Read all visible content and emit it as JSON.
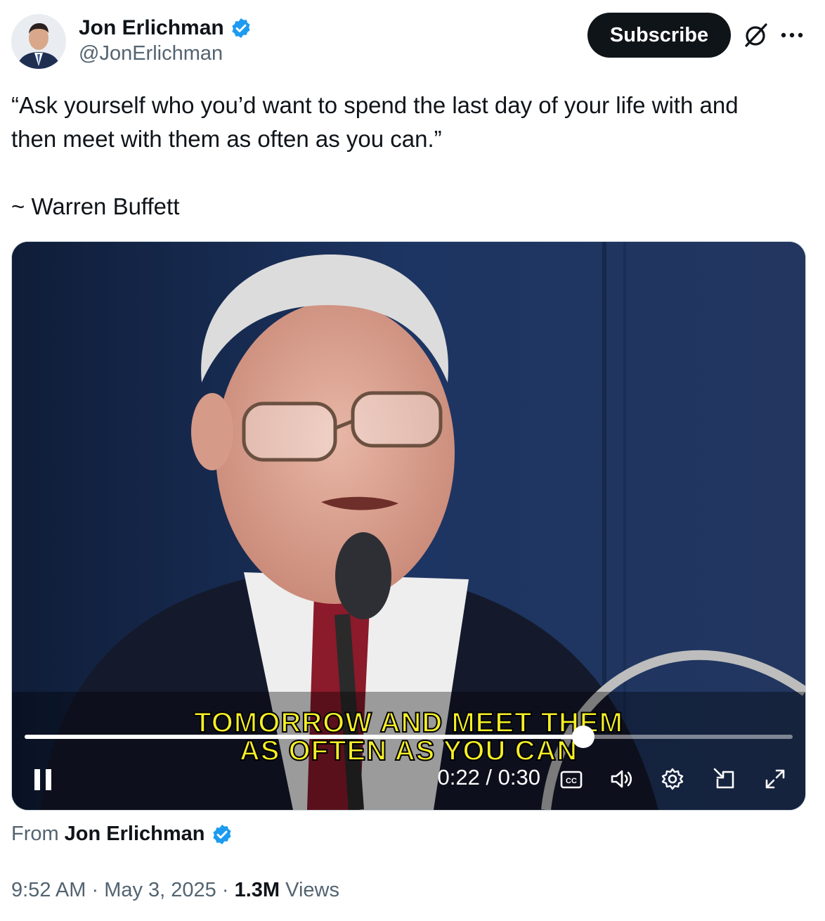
{
  "author": {
    "display_name": "Jon Erlichman",
    "handle": "@JonErlichman",
    "verified_color": "#1d9bf0"
  },
  "header": {
    "subscribe_label": "Subscribe",
    "icons": [
      "grok-icon",
      "more-icon"
    ]
  },
  "tweet": {
    "quote": "“Ask yourself who you’d want to spend the last day of your life with and\nthen meet with them as often as you can.”",
    "attribution": "~ Warren Buffett"
  },
  "video": {
    "subtitle_line1": "TOMORROW AND MEET THEM",
    "subtitle_line2": "AS OFTEN AS YOU CAN",
    "time_display": "0:22 / 0:30",
    "progress_fraction": 0.727,
    "controls": [
      "pause-icon",
      "captions-icon",
      "volume-icon",
      "settings-icon",
      "pip-icon",
      "fullscreen-icon"
    ]
  },
  "footer": {
    "from_label": "From",
    "from_name": "Jon Erlichman",
    "time": "9:52 AM",
    "date": "May 3, 2025",
    "views_count": "1.3M",
    "views_label": "Views",
    "separator": "·"
  }
}
